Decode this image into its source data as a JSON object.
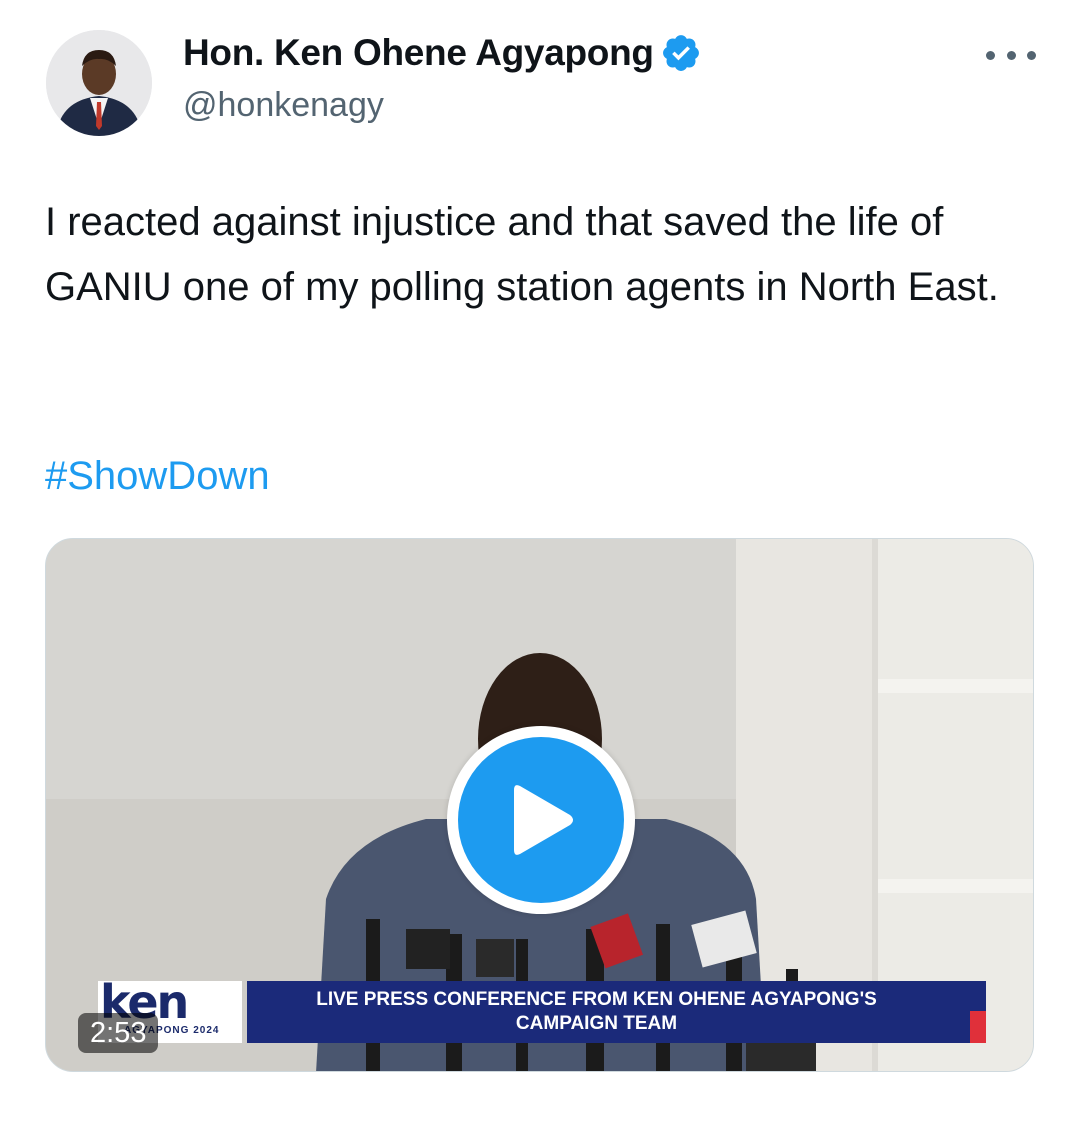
{
  "author": {
    "name": "Hon. Ken Ohene Agyapong",
    "handle": "@honkenagy",
    "verified": true,
    "avatar_icon": "profile-photo"
  },
  "menu": {
    "icon": "more-horizontal-icon"
  },
  "tweet": {
    "text": "I reacted against injustice and that saved the life of GANIU one of my polling station agents in North East.",
    "hashtag": "#ShowDown"
  },
  "video": {
    "duration": "2:53",
    "banner_text_line1": "LIVE PRESS CONFERENCE FROM KEN OHENE AGYAPONG'S",
    "banner_text_line2": "CAMPAIGN TEAM",
    "brand_logo": "ken",
    "brand_sub": "AGYAPONG 2024"
  },
  "colors": {
    "accent": "#1d9bf0",
    "banner": "#1b2a7a",
    "banner_red": "#e0303a",
    "handle": "#536471"
  }
}
